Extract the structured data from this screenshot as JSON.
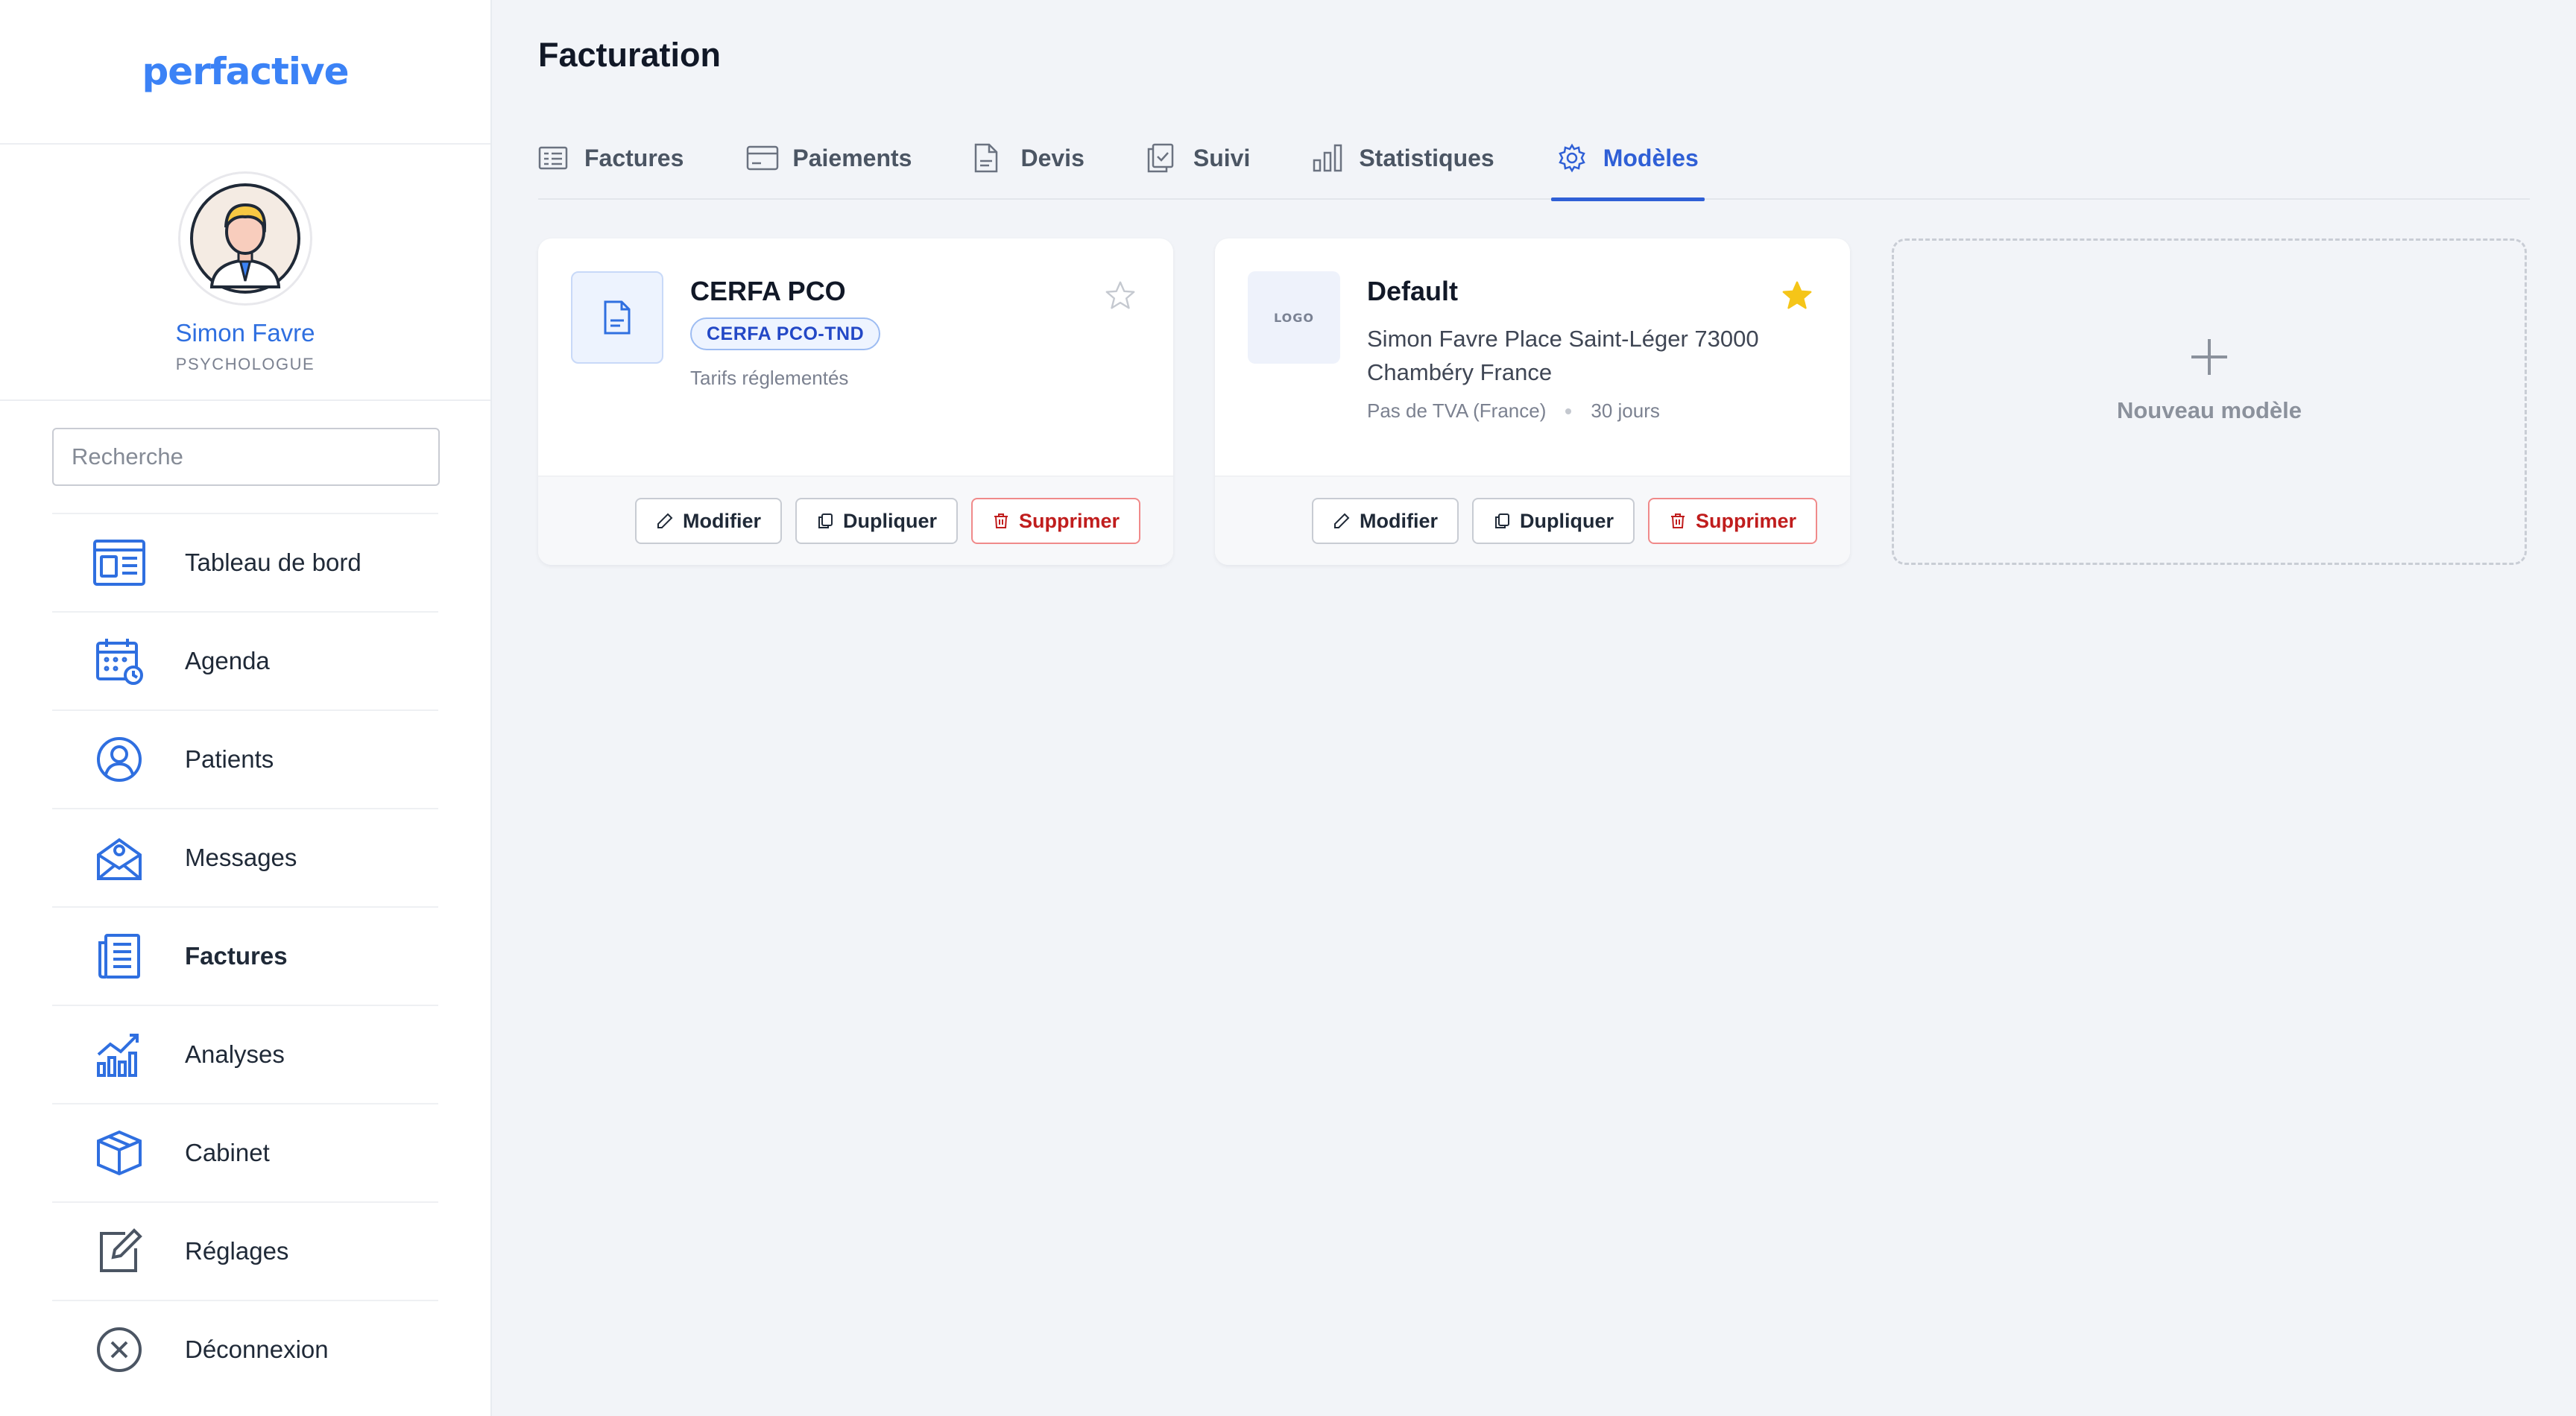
{
  "brand": {
    "logo_text": "perfactive",
    "accent": "#2f5fd6"
  },
  "profile": {
    "name": "Simon Favre",
    "role": "PSYCHOLOGUE"
  },
  "search": {
    "placeholder": "Recherche"
  },
  "nav": {
    "items": [
      {
        "label": "Tableau de bord",
        "icon": "dashboard-icon"
      },
      {
        "label": "Agenda",
        "icon": "calendar-icon"
      },
      {
        "label": "Patients",
        "icon": "user-icon"
      },
      {
        "label": "Messages",
        "icon": "mail-icon"
      },
      {
        "label": "Factures",
        "icon": "invoice-icon",
        "active": true
      },
      {
        "label": "Analyses",
        "icon": "chart-icon"
      },
      {
        "label": "Cabinet",
        "icon": "box-icon"
      },
      {
        "label": "Réglages",
        "icon": "edit-icon"
      },
      {
        "label": "Déconnexion",
        "icon": "close-circle-icon"
      }
    ]
  },
  "page": {
    "title": "Facturation"
  },
  "tabs": [
    {
      "label": "Factures",
      "icon": "invoice-list-icon"
    },
    {
      "label": "Paiements",
      "icon": "card-icon"
    },
    {
      "label": "Devis",
      "icon": "document-icon"
    },
    {
      "label": "Suivi",
      "icon": "clipboard-icon"
    },
    {
      "label": "Statistiques",
      "icon": "bar-chart-icon"
    },
    {
      "label": "Modèles",
      "icon": "gear-icon",
      "active": true
    }
  ],
  "templates": [
    {
      "title": "CERFA PCO",
      "badge": "CERFA PCO-TND",
      "subtext": "Tarifs réglementés",
      "favorite": false,
      "thumb": "document-icon"
    },
    {
      "title": "Default",
      "thumb_label": "LOGO",
      "address": "Simon Favre Place Saint-Léger 73000 Chambéry France",
      "vat": "Pas de TVA (France)",
      "terms": "30 jours",
      "favorite": true,
      "star_color": "#f5c518"
    }
  ],
  "actions": {
    "edit": "Modifier",
    "duplicate": "Dupliquer",
    "delete": "Supprimer"
  },
  "new_template": {
    "label": "Nouveau modèle"
  }
}
